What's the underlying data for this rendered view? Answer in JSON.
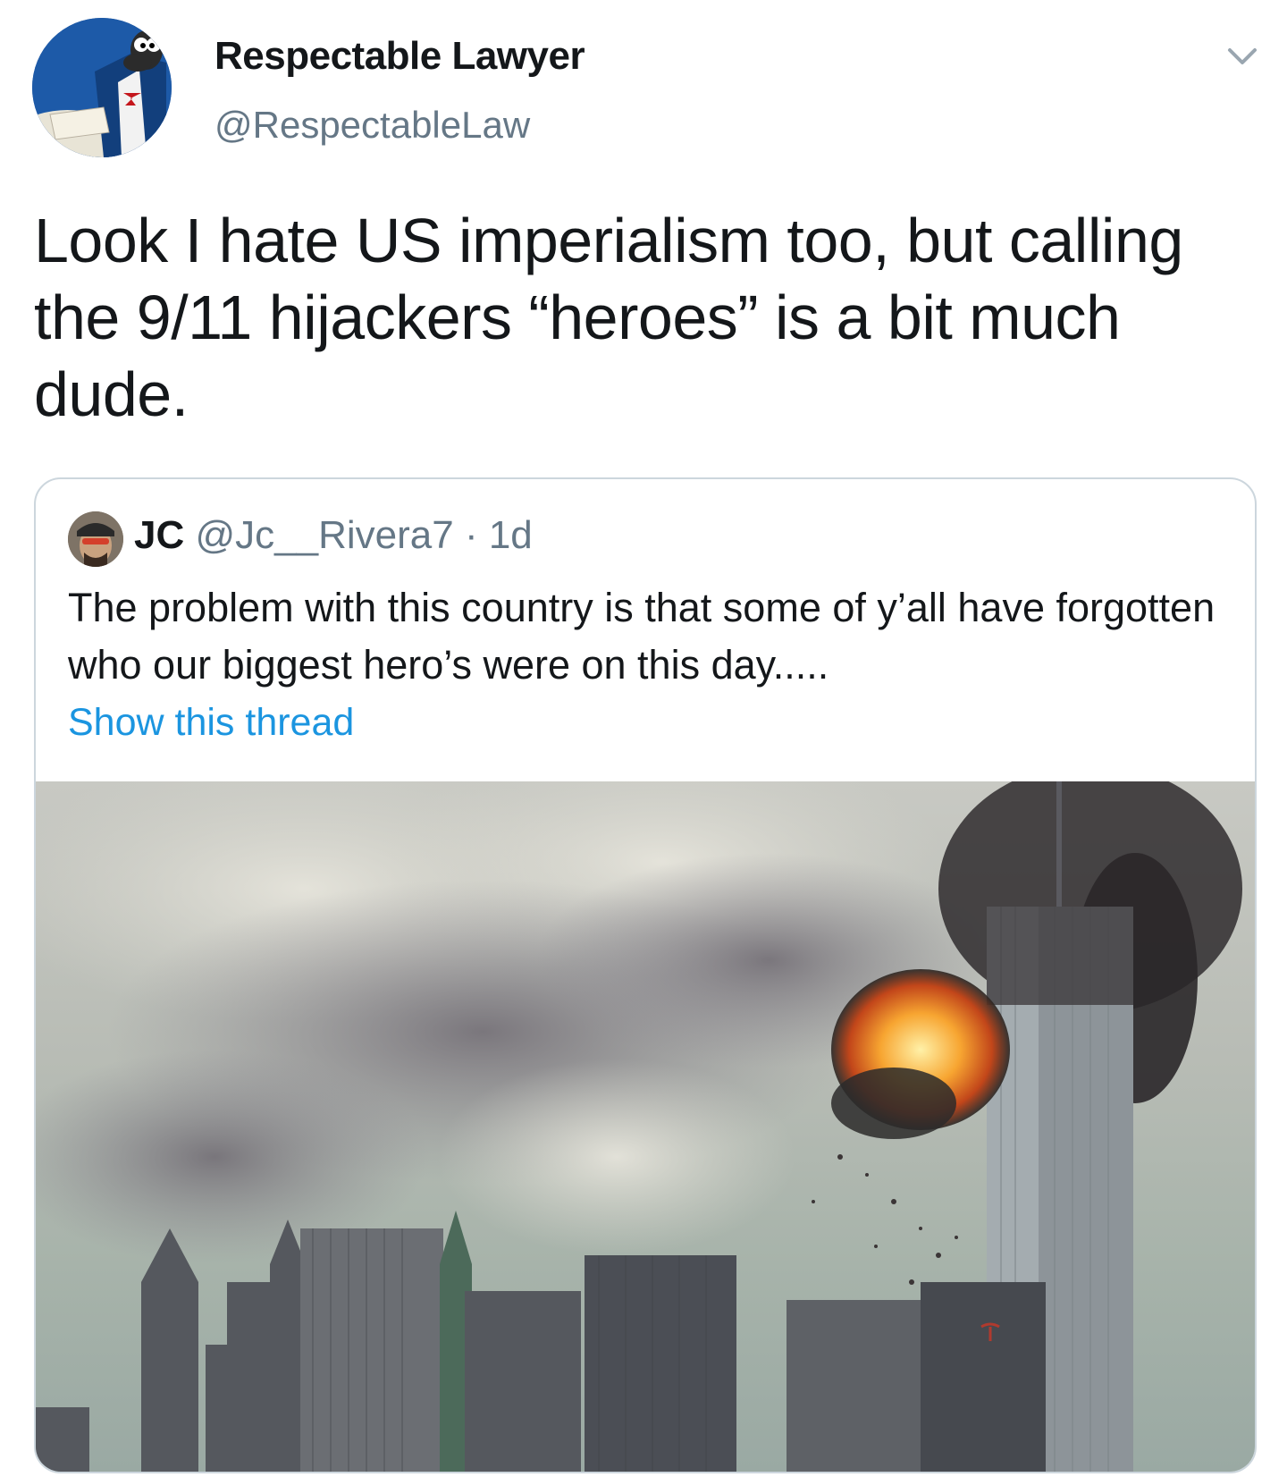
{
  "author": {
    "name": "Respectable Lawyer",
    "handle": "@RespectableLaw"
  },
  "tweet": {
    "text": "Look I hate US imperialism too, but calling the 9/11 hijackers “heroes” is a bit much dude."
  },
  "quoted_tweet": {
    "name": "JC",
    "handle": "@Jc__Rivera7",
    "separator": " · ",
    "time": "1d",
    "text": "The problem with this country is that some of y’all have forgotten who our biggest hero’s were on this day.....",
    "show_thread": "Show this thread"
  },
  "icons": {
    "menu": "chevron-down-icon"
  },
  "colors": {
    "link": "#1b95e0",
    "secondary_text": "#657786",
    "border": "#ccd6dd"
  }
}
